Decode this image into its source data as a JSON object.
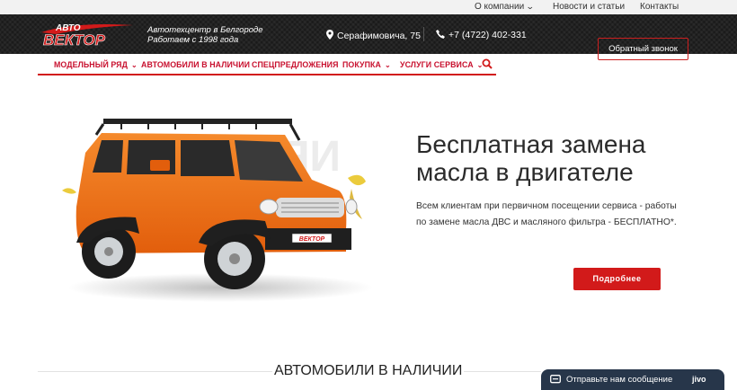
{
  "topbar": {
    "about": "О компании",
    "news": "Новости и статьи",
    "contacts": "Контакты"
  },
  "header": {
    "logo_top": "АВТО",
    "logo_main": "ВЕКТОР",
    "tagline_line1": "Автотехцентр в Белгороде",
    "tagline_line2": "Работаем с 1998 года",
    "address": "Серафимовича, 75",
    "phone": "+7 (4722) 402-331",
    "callback_label": "Обратный звонок"
  },
  "nav": {
    "items": [
      {
        "label": "МОДЕЛЬНЫЙ РЯД",
        "dropdown": true
      },
      {
        "label": "АВТОМОБИЛИ В НАЛИЧИИ",
        "dropdown": false
      },
      {
        "label": "СПЕЦПРЕДЛОЖЕНИЯ",
        "dropdown": false
      },
      {
        "label": "ПОКУПКА",
        "dropdown": true
      },
      {
        "label": "УСЛУГИ СЕРВИСА",
        "dropdown": true
      }
    ],
    "search_icon": "search-icon"
  },
  "hero": {
    "headline": "Бесплатная замена масла в двигателе",
    "description": "Всем клиентам при первичном посещении сервиса - работы по замене масла ДВС и масляного фильтра - БЕСПЛАТНО*.",
    "button_label": "Подробнее",
    "car_plate": "ВЕКТОР"
  },
  "section": {
    "title": "АВТОМОБИЛИ В НАЛИЧИИ"
  },
  "chat": {
    "label": "Отправьте нам сообщение",
    "brand": "jivo"
  },
  "colors": {
    "accent": "#d21a1a",
    "header_bg": "#1a1a1a",
    "car_orange": "#f06a14",
    "chat_bg": "#27364a"
  }
}
